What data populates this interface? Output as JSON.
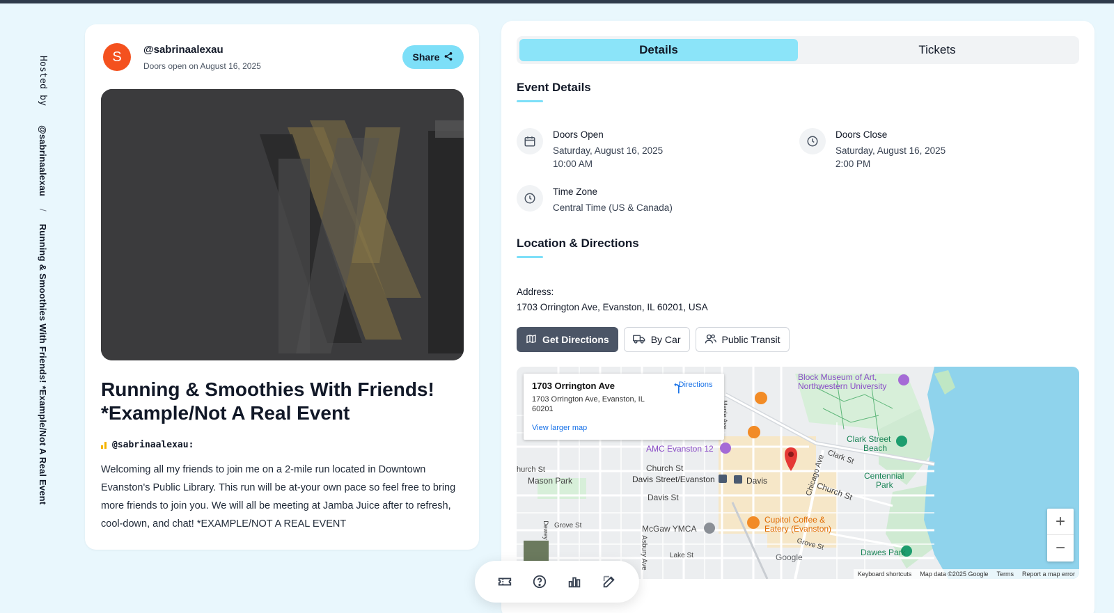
{
  "sidebar_vertical": {
    "hosted_by_label": "Hosted by",
    "host_handle": "@sabrinaalexau",
    "separator": "/",
    "event_title": "Running & Smoothies With Friends! *Example/Not A Real Event"
  },
  "event_card": {
    "avatar_letter": "S",
    "host_handle": "@sabrinaalexau",
    "doors_subtitle": "Doors open on August 16, 2025",
    "share_label": "Share",
    "title": "Running & Smoothies With Friends! *Example/Not A Real Event",
    "host_line": "@sabrinaalexau:",
    "description": "Welcoming all my friends to join me on a 2-mile run located in Downtown Evanston's Public Library. This run will be at-your own pace so feel free to bring more friends to join you. We will all be meeting at Jamba Juice after to refresh, cool-down, and chat! *EXAMPLE/NOT A REAL EVENT"
  },
  "tabs": [
    {
      "label": "Details",
      "active": true
    },
    {
      "label": "Tickets",
      "active": false
    }
  ],
  "event_details": {
    "section_title": "Event Details",
    "doors_open": {
      "label": "Doors Open",
      "date": "Saturday, August 16, 2025",
      "time": "10:00 AM"
    },
    "doors_close": {
      "label": "Doors Close",
      "date": "Saturday, August 16, 2025",
      "time": "2:00 PM"
    },
    "time_zone": {
      "label": "Time Zone",
      "value": "Central Time (US & Canada)"
    }
  },
  "location": {
    "section_title": "Location & Directions",
    "address_label": "Address:",
    "address": "1703 Orrington Ave, Evanston, IL 60201, USA",
    "buttons": {
      "get_directions": "Get Directions",
      "by_car": "By Car",
      "public_transit": "Public Transit"
    }
  },
  "map": {
    "info_title": "1703 Orrington Ave",
    "info_address": "1703 Orrington Ave, Evanston, IL 60201",
    "directions_label": "Directions",
    "view_larger": "View larger map",
    "labels": {
      "block_museum": "Block Museum of Art,",
      "northwestern": "Northwestern University",
      "amc": "AMC Evanston 12",
      "church_st_left": "hurch St",
      "mason_park": "Mason Park",
      "church_st": "Church St",
      "davis_station": "Davis Street/Evanston",
      "davis": "Davis",
      "davis_st": "Davis St",
      "clark_beach": "Clark Street",
      "beach": "Beach",
      "clark_st": "Clark St",
      "centennial": "Centennial",
      "park": "Park",
      "church_st_right": "Church St",
      "chicago_ave": "Chicago Ave",
      "maple_ave": "Maple Ave",
      "grove_st_left": "Grove St",
      "mcgaw": "McGaw YMCA",
      "cupitol": "Cupitol Coffee &",
      "eatery": "Eatery (Evanston)",
      "grove_st_right": "Grove St",
      "lake_st": "Lake St",
      "dawes_park": "Dawes Park",
      "asbury_ave": "Asbury Ave",
      "dewey": "Dewey",
      "google": "Google"
    },
    "zoom_in": "+",
    "zoom_out": "−",
    "footer": {
      "shortcuts": "Keyboard shortcuts",
      "data": "Map data ©2025 Google",
      "terms": "Terms",
      "report": "Report a map error"
    }
  },
  "colors": {
    "accent": "#7ddff8",
    "tab_active": "#8be4f9",
    "avatar": "#f4511e",
    "primary_button": "#4b5566",
    "water": "#8fd3ec"
  },
  "dock_icons": [
    "ticket-icon",
    "help-icon",
    "bar-chart-icon",
    "edit-icon"
  ]
}
